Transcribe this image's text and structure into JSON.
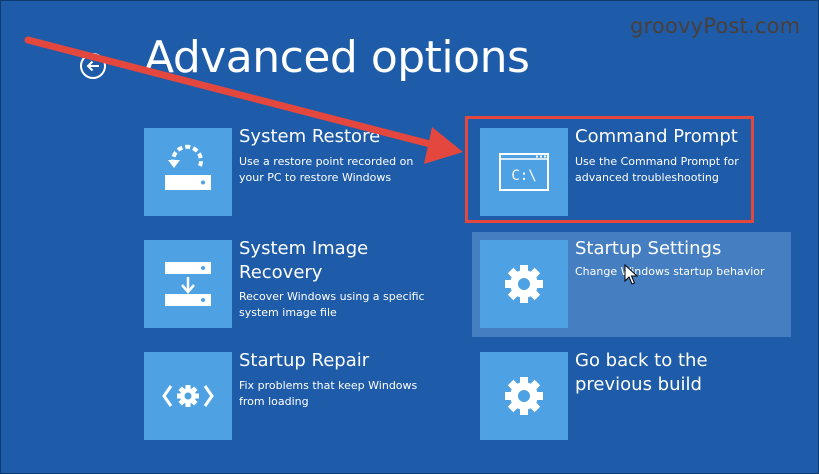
{
  "watermark": "groovyPost.com",
  "header": {
    "title": "Advanced options"
  },
  "options": [
    {
      "id": "system-restore",
      "title": "System Restore",
      "description": "Use a restore point recorded on your PC to restore Windows",
      "icon": "restore-icon"
    },
    {
      "id": "command-prompt",
      "title": "Command Prompt",
      "description": "Use the Command Prompt for advanced troubleshooting",
      "icon": "command-prompt-icon",
      "icon_text": "C:\\",
      "highlighted": true
    },
    {
      "id": "system-image-recovery",
      "title": "System Image Recovery",
      "title_lines": [
        "System Image",
        "Recovery"
      ],
      "description": "Recover Windows using a specific system image file",
      "icon": "system-image-icon"
    },
    {
      "id": "startup-settings",
      "title": "Startup Settings",
      "description": "Change Windows startup behavior",
      "icon": "gear-icon",
      "hovered": true
    },
    {
      "id": "startup-repair",
      "title": "Startup Repair",
      "description": "Fix problems that keep Windows from loading",
      "icon": "repair-icon"
    },
    {
      "id": "go-back",
      "title": "Go back to the previous build",
      "title_lines": [
        "Go back to the",
        "previous build"
      ],
      "description": "",
      "icon": "gear-icon"
    }
  ],
  "colors": {
    "background": "#1e5ba8",
    "tile_icon": "#4ea2e3",
    "annotation": "#e4473e"
  }
}
